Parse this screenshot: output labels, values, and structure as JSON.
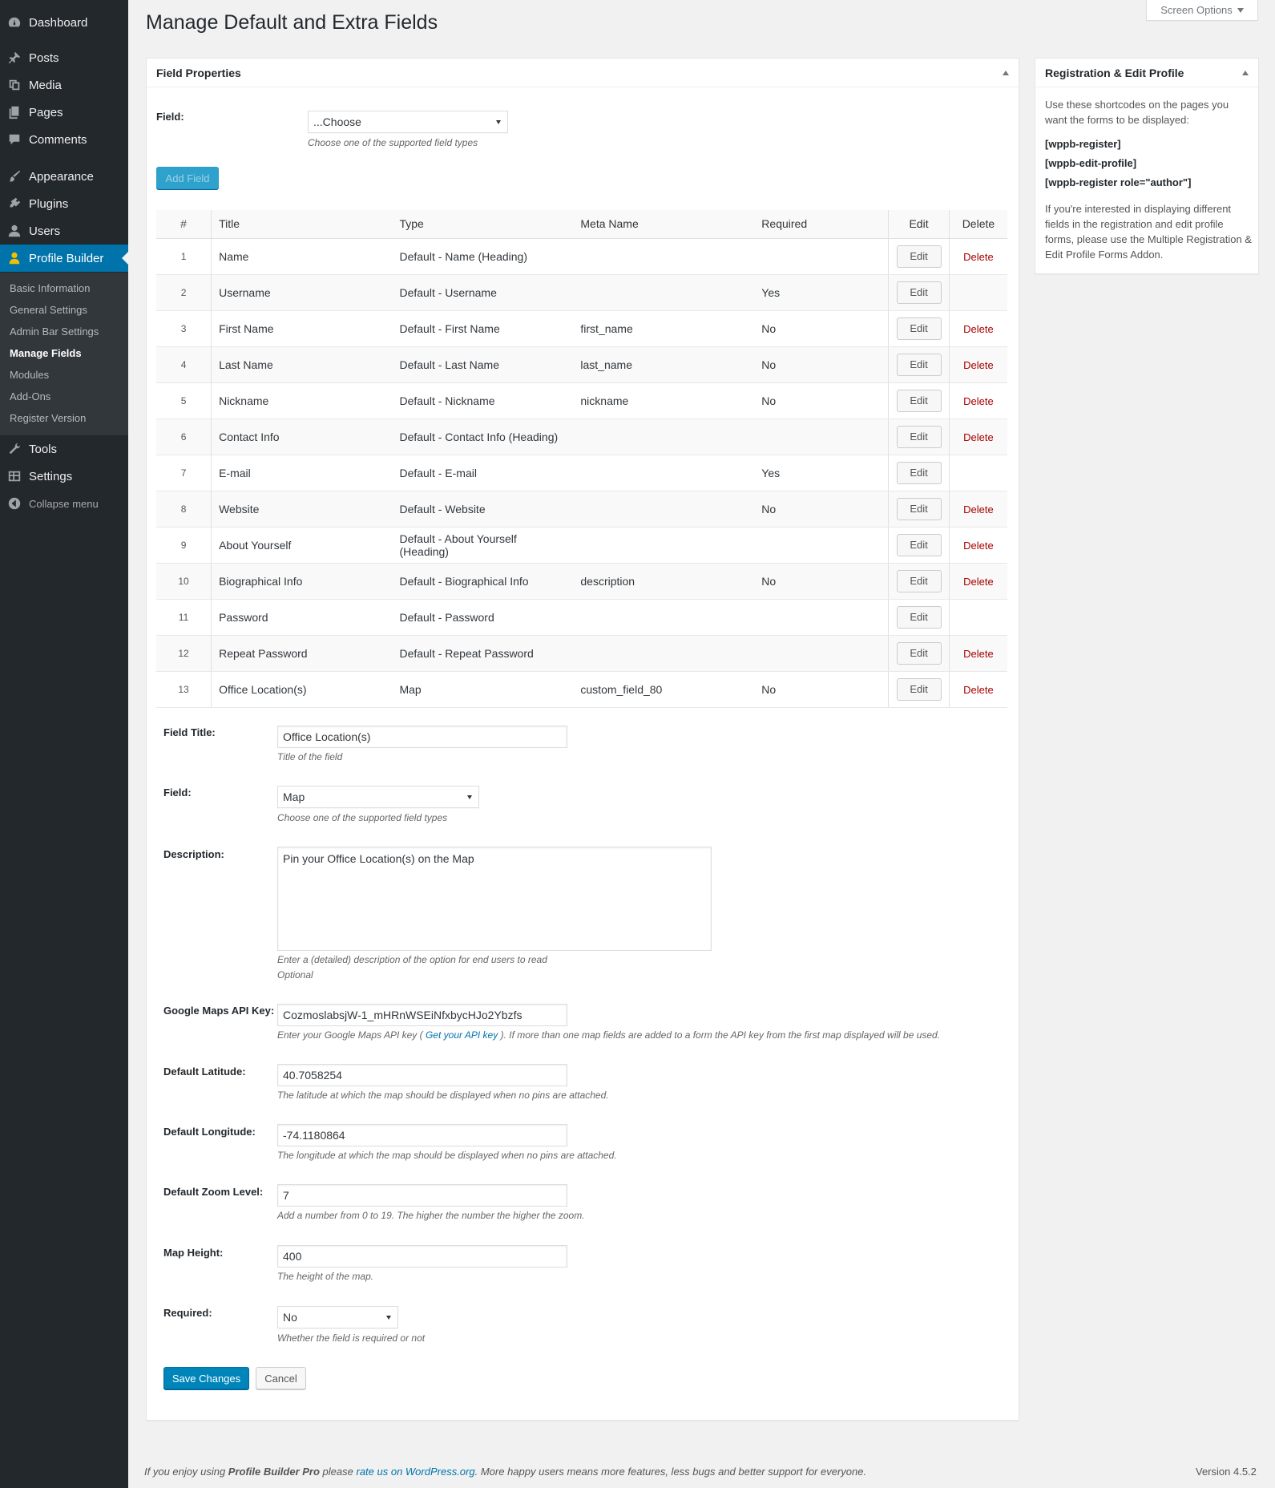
{
  "menu": {
    "dashboard": "Dashboard",
    "posts": "Posts",
    "media": "Media",
    "pages": "Pages",
    "comments": "Comments",
    "appearance": "Appearance",
    "plugins": "Plugins",
    "users": "Users",
    "profile_builder": "Profile Builder",
    "tools": "Tools",
    "settings": "Settings",
    "collapse": "Collapse menu"
  },
  "submenu": [
    "Basic Information",
    "General Settings",
    "Admin Bar Settings",
    "Manage Fields",
    "Modules",
    "Add-Ons",
    "Register Version"
  ],
  "page_title": "Manage Default and Extra Fields",
  "screen_options": "Screen Options",
  "field_properties": {
    "title": "Field Properties",
    "field_label": "Field:",
    "field_select": "...Choose",
    "field_desc": "Choose one of the supported field types",
    "add_button": "Add Field"
  },
  "table": {
    "headers": [
      "#",
      "Title",
      "Type",
      "Meta Name",
      "Required",
      "Edit",
      "Delete"
    ],
    "rows": [
      [
        "1",
        "Name",
        "Default - Name (Heading)",
        "",
        "",
        "Edit",
        "Delete"
      ],
      [
        "2",
        "Username",
        "Default - Username",
        "",
        "Yes",
        "Edit",
        ""
      ],
      [
        "3",
        "First Name",
        "Default - First Name",
        "first_name",
        "No",
        "Edit",
        "Delete"
      ],
      [
        "4",
        "Last Name",
        "Default - Last Name",
        "last_name",
        "No",
        "Edit",
        "Delete"
      ],
      [
        "5",
        "Nickname",
        "Default - Nickname",
        "nickname",
        "No",
        "Edit",
        "Delete"
      ],
      [
        "6",
        "Contact Info",
        "Default - Contact Info (Heading)",
        "",
        "",
        "Edit",
        "Delete"
      ],
      [
        "7",
        "E-mail",
        "Default - E-mail",
        "",
        "Yes",
        "Edit",
        ""
      ],
      [
        "8",
        "Website",
        "Default - Website",
        "",
        "No",
        "Edit",
        "Delete"
      ],
      [
        "9",
        "About Yourself",
        "Default - About Yourself (Heading)",
        "",
        "",
        "Edit",
        "Delete"
      ],
      [
        "10",
        "Biographical Info",
        "Default - Biographical Info",
        "description",
        "No",
        "Edit",
        "Delete"
      ],
      [
        "11",
        "Password",
        "Default - Password",
        "",
        "",
        "Edit",
        ""
      ],
      [
        "12",
        "Repeat Password",
        "Default - Repeat Password",
        "",
        "",
        "Edit",
        "Delete"
      ],
      [
        "13",
        "Office Location(s)",
        "Map",
        "custom_field_80",
        "No",
        "Edit",
        "Delete"
      ]
    ]
  },
  "edit_form": {
    "field_title_label": "Field Title:",
    "field_title_value": "Office Location(s)",
    "field_title_desc": "Title of the field",
    "field_label": "Field:",
    "field_value": "Map",
    "field_desc": "Choose one of the supported field types",
    "description_label": "Description:",
    "description_value": "Pin your Office Location(s) on the Map",
    "description_desc": "Enter a (detailed) description of the option for end users to read",
    "description_optional": "Optional",
    "api_key_label": "Google Maps API Key:",
    "api_key_value": "CozmoslabsjW-1_mHRnWSEiNfxbycHJo2Ybzfs",
    "api_key_desc_before": "Enter your Google Maps API key ( ",
    "api_key_link": "Get your API key",
    "api_key_desc_after": " ). If more than one map fields are added to a form the API key from the first map displayed will be used.",
    "latitude_label": "Default Latitude:",
    "latitude_value": "40.7058254",
    "latitude_desc": "The latitude at which the map should be displayed when no pins are attached.",
    "longitude_label": "Default Longitude:",
    "longitude_value": "-74.1180864",
    "longitude_desc": "The longitude at which the map should be displayed when no pins are attached.",
    "zoom_label": "Default Zoom Level:",
    "zoom_value": "7",
    "zoom_desc": "Add a number from 0 to 19. The higher the number the higher the zoom.",
    "height_label": "Map Height:",
    "height_value": "400",
    "height_desc": "The height of the map.",
    "required_label": "Required:",
    "required_value": "No",
    "required_desc": "Whether the field is required or not",
    "save_button": "Save Changes",
    "cancel_button": "Cancel"
  },
  "sidebar_box": {
    "title": "Registration & Edit Profile",
    "intro": "Use these shortcodes on the pages you want the forms to be displayed:",
    "codes": [
      "[wppb-register]",
      "[wppb-edit-profile]",
      "[wppb-register role=\"author\"]"
    ],
    "note": "If you're interested in displaying different fields in the registration and edit profile forms, please use the Multiple Registration & Edit Profile Forms Addon."
  },
  "footer": {
    "before": "If you enjoy using ",
    "product": "Profile Builder Pro",
    "middle": " please ",
    "link": "rate us on WordPress.org",
    "after": ". More happy users means more features, less bugs and better support for everyone.",
    "version": "Version 4.5.2"
  },
  "colors": {
    "sidebar_bg": "#23282d",
    "submenu_bg": "#32373c",
    "accent": "#0073aa",
    "primary_button": "#0085ba",
    "delete_link": "#a00"
  }
}
